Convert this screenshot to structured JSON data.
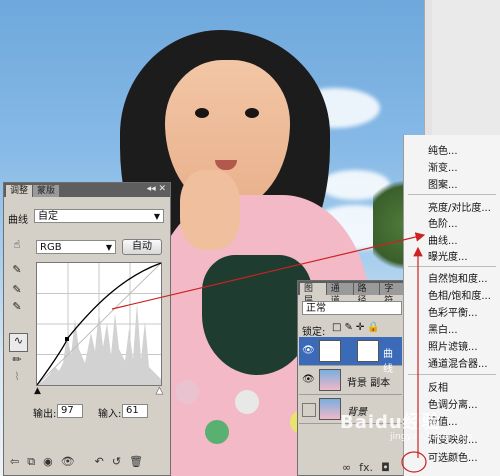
{
  "curves_panel": {
    "tabs": [
      "调整",
      "蒙版"
    ],
    "preset_label": "曲线",
    "preset_value": "自定",
    "channel_value": "RGB",
    "auto_button": "自动",
    "output_label": "输出:",
    "output_value": "97",
    "input_label": "输入:",
    "input_value": "61"
  },
  "layers_panel": {
    "tabs": [
      "图层",
      "通道",
      "路径",
      "字符"
    ],
    "blend_mode": "正常",
    "lock_label": "锁定:",
    "layers": [
      {
        "name": "曲线",
        "selected": true
      },
      {
        "name": "背景 副本",
        "selected": false
      },
      {
        "name": "背景",
        "selected": false
      }
    ]
  },
  "adjust_menu": {
    "groups": [
      [
        "纯色...",
        "渐变...",
        "图案..."
      ],
      [
        "亮度/对比度...",
        "色阶...",
        "曲线...",
        "曝光度..."
      ],
      [
        "自然饱和度...",
        "色相/饱和度...",
        "色彩平衡...",
        "黑白...",
        "照片滤镜...",
        "通道混合器..."
      ],
      [
        "反相",
        "色调分离...",
        "阈值...",
        "渐变映射...",
        "可选颜色..."
      ]
    ]
  },
  "watermark": {
    "brand": "Baidu经验",
    "url": "jingyan.baidu.com"
  },
  "colors": {
    "arrow": "#cc2222",
    "selected_layer": "#3a6ab8",
    "panel_bg": "#d4d0c8"
  }
}
